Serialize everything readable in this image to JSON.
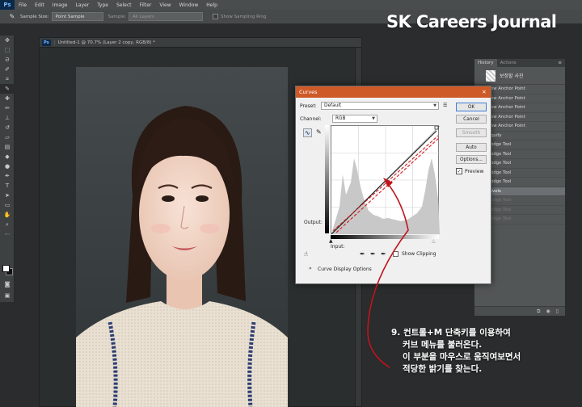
{
  "app": {
    "logo": "Ps"
  },
  "menu": [
    "File",
    "Edit",
    "Image",
    "Layer",
    "Type",
    "Select",
    "Filter",
    "View",
    "Window",
    "Help"
  ],
  "options": {
    "sample_size_label": "Sample Size:",
    "sample_size_value": "Point Sample",
    "sample_label": "Sample:",
    "sample_value": "All Layers",
    "show_ring_label": "Show Sampling Ring"
  },
  "document": {
    "tab_title": "Untitled-1 @ 70.7% (Layer 2 copy, RGB/8) *"
  },
  "history_panel": {
    "tabs": [
      "History",
      "Actions"
    ],
    "snapshot_label": "보정할 사진",
    "items": [
      {
        "label": "New Anchor Point",
        "state": "normal"
      },
      {
        "label": "New Anchor Point",
        "state": "normal"
      },
      {
        "label": "New Anchor Point",
        "state": "normal"
      },
      {
        "label": "New Anchor Point",
        "state": "normal"
      },
      {
        "label": "New Anchor Point",
        "state": "normal"
      },
      {
        "label": "Liquify",
        "state": "normal"
      },
      {
        "label": "Dodge Tool",
        "state": "normal"
      },
      {
        "label": "Dodge Tool",
        "state": "normal"
      },
      {
        "label": "Dodge Tool",
        "state": "normal"
      },
      {
        "label": "Dodge Tool",
        "state": "normal"
      },
      {
        "label": "Dodge Tool",
        "state": "normal"
      },
      {
        "label": "Levels",
        "state": "active"
      },
      {
        "label": "Dodge Tool",
        "state": "disabled"
      },
      {
        "label": "Dodge Tool",
        "state": "disabled"
      },
      {
        "label": "Dodge Tool",
        "state": "disabled"
      }
    ]
  },
  "curves_dialog": {
    "title": "Curves",
    "close": "✕",
    "preset_label": "Preset:",
    "preset_value": "Default",
    "channel_label": "Channel:",
    "channel_value": "RGB",
    "output_label": "Output:",
    "input_label": "Input:",
    "show_clipping_label": "Show Clipping",
    "curve_display_options_label": "Curve Display Options",
    "buttons": {
      "ok": "OK",
      "cancel": "Cancel",
      "smooth": "Smooth",
      "auto": "Auto",
      "options": "Options..."
    },
    "preview_label": "Preview",
    "preview_checked": true
  },
  "brand": {
    "text": "SK Careers Journal"
  },
  "callout": {
    "lines": [
      "9. 컨트롤+M 단축키를 이용하여",
      "   커브 메뉴를 불러온다.",
      "   이 부분을 마우스로 움직여보면서",
      "   적당한 밝기를 찾는다."
    ]
  },
  "colors": {
    "accent_title": "#ce5a28",
    "annotation_arrow": "#c0141c",
    "app_bg": "#2a2c2d"
  }
}
